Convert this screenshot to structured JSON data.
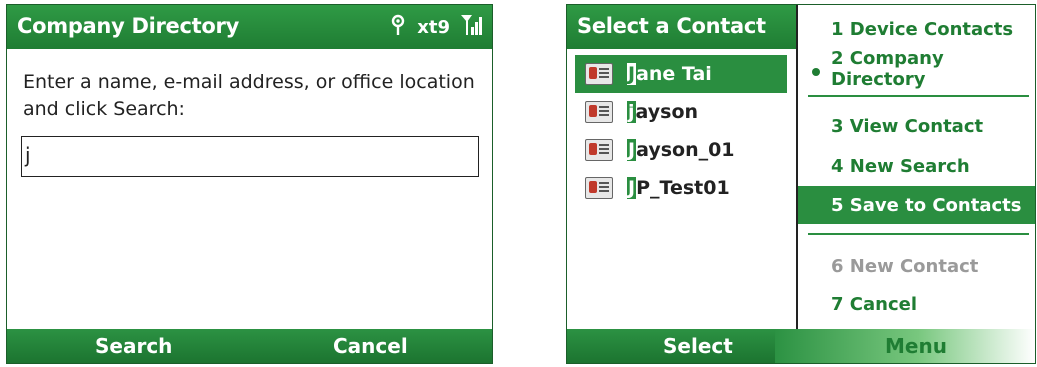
{
  "left_screen": {
    "title": "Company Directory",
    "status": {
      "xt9": "xt9",
      "icons": [
        "antenna-icon",
        "signal-icon"
      ]
    },
    "prompt": "Enter a name, e-mail address, or office location and click Search:",
    "input_value": "j",
    "softkeys": {
      "left": "Search",
      "right": "Cancel"
    }
  },
  "right_screen": {
    "title": "Select a Contact",
    "contacts": [
      {
        "first": "J",
        "rest": "ane Tai",
        "selected": true
      },
      {
        "first": "j",
        "rest": "ayson",
        "selected": false
      },
      {
        "first": "J",
        "rest": "ayson_01",
        "selected": false
      },
      {
        "first": "J",
        "rest": "P_Test01",
        "selected": false
      }
    ],
    "menu": [
      {
        "label": "1 Device Contacts",
        "state": "normal"
      },
      {
        "label": "2 Company Directory",
        "state": "checked"
      },
      {
        "label": "3 View Contact",
        "state": "normal"
      },
      {
        "label": "4 New Search",
        "state": "normal"
      },
      {
        "label": "5 Save to Contacts",
        "state": "selected"
      },
      {
        "label": "6 New Contact",
        "state": "disabled"
      },
      {
        "label": "7 Cancel",
        "state": "normal"
      }
    ],
    "softkeys": {
      "left": "Select",
      "right": "Menu"
    }
  },
  "colors": {
    "title_bar": "#2f9a45",
    "menu_text": "#1f7d33",
    "disabled": "#9a9a9a"
  }
}
